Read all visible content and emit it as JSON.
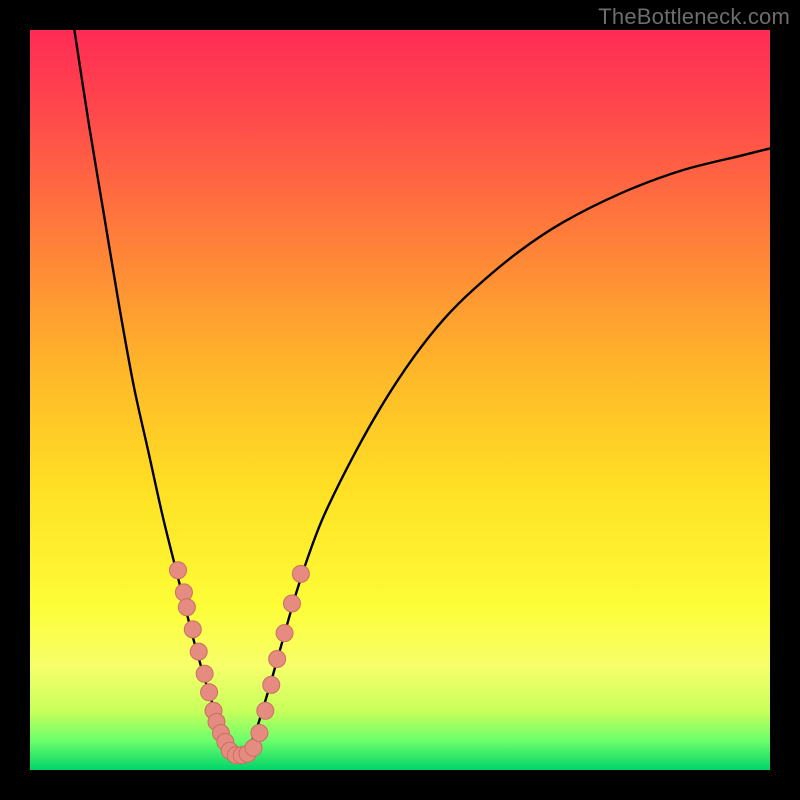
{
  "watermark": "TheBottleneck.com",
  "colors": {
    "background": "#000000",
    "curve": "#000000",
    "marker_fill": "#e58b7f",
    "marker_stroke": "#c96f63",
    "gradient_stops": [
      "#ff2b55",
      "#ff4b4b",
      "#ff7e3a",
      "#ffb42a",
      "#ffe024",
      "#fdfd38",
      "#f7ff6a",
      "#c8ff5a",
      "#6dff6a",
      "#00d46a"
    ]
  },
  "chart_data": {
    "type": "line",
    "title": "",
    "xlabel": "",
    "ylabel": "",
    "xlim": [
      0,
      100
    ],
    "ylim": [
      0,
      100
    ],
    "grid": false,
    "legend": null,
    "note": "x and y are percentages of the plot area (0,0 at bottom-left); axes are implicit/unlabeled in the source image.",
    "series": [
      {
        "name": "left-arm",
        "x": [
          6,
          8,
          10,
          12,
          14,
          16,
          18,
          20,
          22,
          24,
          25,
          26,
          27,
          28
        ],
        "y": [
          100,
          87,
          75,
          63,
          52,
          43,
          34,
          26,
          18,
          11,
          8,
          5,
          3,
          2
        ]
      },
      {
        "name": "right-arm",
        "x": [
          28,
          30,
          32,
          34,
          36,
          38,
          40,
          44,
          48,
          52,
          56,
          60,
          66,
          72,
          80,
          88,
          96,
          100
        ],
        "y": [
          2,
          4,
          10,
          17,
          24,
          30,
          35,
          43,
          50,
          56,
          61,
          65,
          70,
          74,
          78,
          81,
          83,
          84
        ]
      }
    ],
    "markers": {
      "name": "highlighted-points",
      "points": [
        {
          "x": 20.0,
          "y": 27.0
        },
        {
          "x": 20.8,
          "y": 24.0
        },
        {
          "x": 21.2,
          "y": 22.0
        },
        {
          "x": 22.0,
          "y": 19.0
        },
        {
          "x": 22.8,
          "y": 16.0
        },
        {
          "x": 23.6,
          "y": 13.0
        },
        {
          "x": 24.2,
          "y": 10.5
        },
        {
          "x": 24.8,
          "y": 8.0
        },
        {
          "x": 25.2,
          "y": 6.5
        },
        {
          "x": 25.8,
          "y": 5.0
        },
        {
          "x": 26.4,
          "y": 3.8
        },
        {
          "x": 27.0,
          "y": 2.6
        },
        {
          "x": 27.8,
          "y": 2.0
        },
        {
          "x": 28.6,
          "y": 2.0
        },
        {
          "x": 29.4,
          "y": 2.2
        },
        {
          "x": 30.2,
          "y": 3.0
        },
        {
          "x": 31.0,
          "y": 5.0
        },
        {
          "x": 31.8,
          "y": 8.0
        },
        {
          "x": 32.6,
          "y": 11.5
        },
        {
          "x": 33.4,
          "y": 15.0
        },
        {
          "x": 34.4,
          "y": 18.5
        },
        {
          "x": 35.4,
          "y": 22.5
        },
        {
          "x": 36.6,
          "y": 26.5
        }
      ]
    }
  }
}
